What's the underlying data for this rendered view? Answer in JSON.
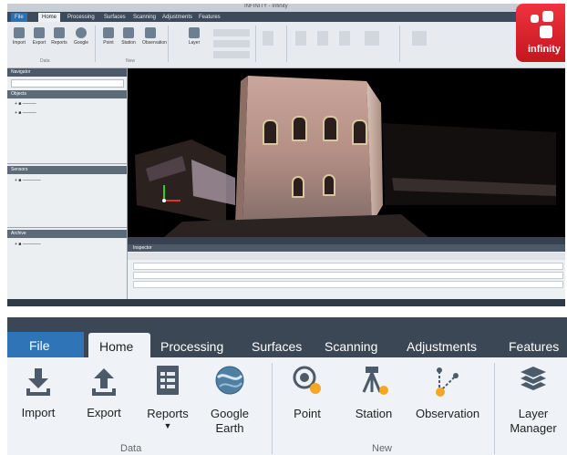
{
  "window": {
    "title": "INFINITY - Infinity"
  },
  "tabs": [
    "File",
    "Home",
    "Processing",
    "Surfaces",
    "Scanning",
    "Adjustments",
    "Features"
  ],
  "active_tab": "Home",
  "ribbon": {
    "buttons": {
      "import": "Import",
      "export": "Export",
      "reports": "Reports",
      "google_earth_line1": "Google",
      "google_earth_line2": "Earth",
      "point": "Point",
      "station": "Station",
      "observation": "Observation",
      "layer_manager_line1": "Layer",
      "layer_manager_line2": "Manager"
    },
    "groups": {
      "data": "Data",
      "new": "New"
    }
  },
  "logo": {
    "text": "infinity",
    "color": "#e3232d"
  },
  "panels": {
    "navigator": "Navigator",
    "objects": "Objects",
    "sensors": "Sensors",
    "archive": "Archive",
    "inspector": "Inspector"
  },
  "colors": {
    "tab_bar": "#3b4754",
    "file_tab": "#2f74b7",
    "ribbon_bg": "#eff3f7",
    "accent_orange": "#f5a623"
  }
}
